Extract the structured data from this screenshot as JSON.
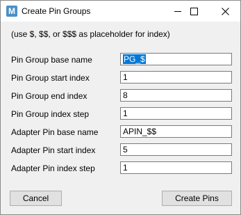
{
  "window": {
    "title": "Create Pin Groups",
    "app_icon_letter": "M",
    "controls": [
      "minimize",
      "maximize",
      "close"
    ]
  },
  "hint": "(use $, $$, or $$$ as placeholder for index)",
  "fields": [
    {
      "label": "Pin Group base name",
      "value": "PG_$"
    },
    {
      "label": "Pin Group start index",
      "value": "1"
    },
    {
      "label": "Pin Group end index",
      "value": "8"
    },
    {
      "label": "Pin Group index step",
      "value": "1"
    },
    {
      "label": "Adapter Pin base name",
      "value": "APIN_$$"
    },
    {
      "label": "Adapter Pin start index",
      "value": "5"
    },
    {
      "label": "Adapter Pin index step",
      "value": "1"
    }
  ],
  "buttons": {
    "cancel": "Cancel",
    "create": "Create Pins"
  },
  "colors": {
    "selection": "#0078d7",
    "dialog_bg": "#f0f0f0",
    "app_icon": "#4a90c8"
  }
}
